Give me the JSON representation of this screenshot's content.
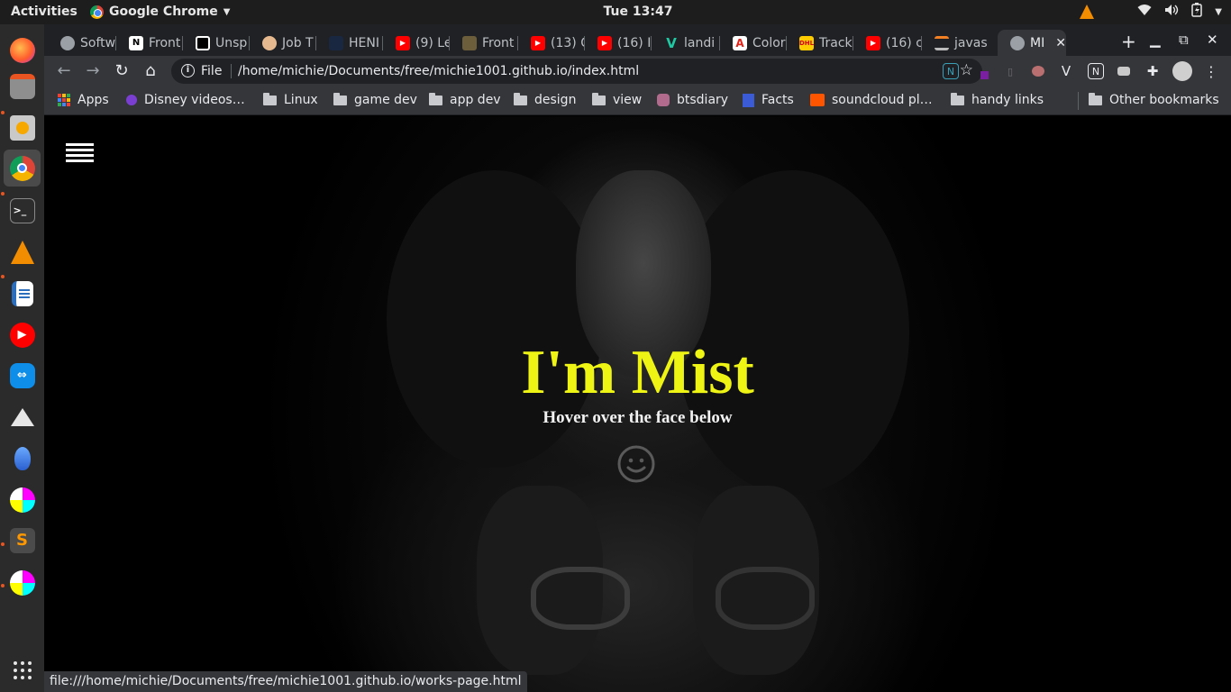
{
  "topbar": {
    "activities": "Activities",
    "app_name": "Google Chrome",
    "clock": "Tue 13:47"
  },
  "dock": {
    "items": [
      "firefox-icon",
      "files-icon",
      "rhythmbox-icon",
      "chrome-icon",
      "terminal-icon",
      "vlc-icon",
      "writer-icon",
      "youtube-music-icon",
      "teamviewer-icon",
      "inkscape-icon",
      "app-icon",
      "krita-icon",
      "sublime-icon",
      "krita-icon",
      "show-apps-icon"
    ]
  },
  "tabs": [
    {
      "label": "Softw",
      "icon": "globe-icon"
    },
    {
      "label": "Front",
      "icon": "notion-icon"
    },
    {
      "label": "Unsp",
      "icon": "unsplash-icon"
    },
    {
      "label": "Job T",
      "icon": "hand-icon"
    },
    {
      "label": "HENI",
      "icon": "app-icon"
    },
    {
      "label": "(9) Le",
      "icon": "youtube-icon"
    },
    {
      "label": "Front",
      "icon": "cap-icon"
    },
    {
      "label": "(13) C",
      "icon": "youtube-icon"
    },
    {
      "label": "(16) I",
      "icon": "youtube-icon"
    },
    {
      "label": "landi",
      "icon": "v-icon"
    },
    {
      "label": "Color",
      "icon": "adobe-icon"
    },
    {
      "label": "Track",
      "icon": "dhl-icon"
    },
    {
      "label": "(16) c",
      "icon": "youtube-icon"
    },
    {
      "label": "javas",
      "icon": "stackoverflow-icon"
    },
    {
      "label": "MI",
      "icon": "globe-icon"
    }
  ],
  "toolbar": {
    "scheme": "File",
    "url": "/home/michie/Documents/free/michie1001.github.io/index.html"
  },
  "bookmarks": {
    "apps": "Apps",
    "items": [
      "Disney videos…",
      "Linux",
      "game dev",
      "app dev",
      "design",
      "view",
      "btsdiary",
      "Facts",
      "soundcloud pl…",
      "handy links"
    ],
    "other": "Other bookmarks"
  },
  "hero": {
    "title": "I'm Mist",
    "subtitle": "Hover over the face below"
  },
  "status": {
    "link": "file:///home/michie/Documents/free/michie1001.github.io/works-page.html"
  },
  "colors": {
    "title": "#eef414",
    "subtitle": "#f2f2f2",
    "tab_active": "#35363a",
    "tabstrip": "#202124"
  }
}
